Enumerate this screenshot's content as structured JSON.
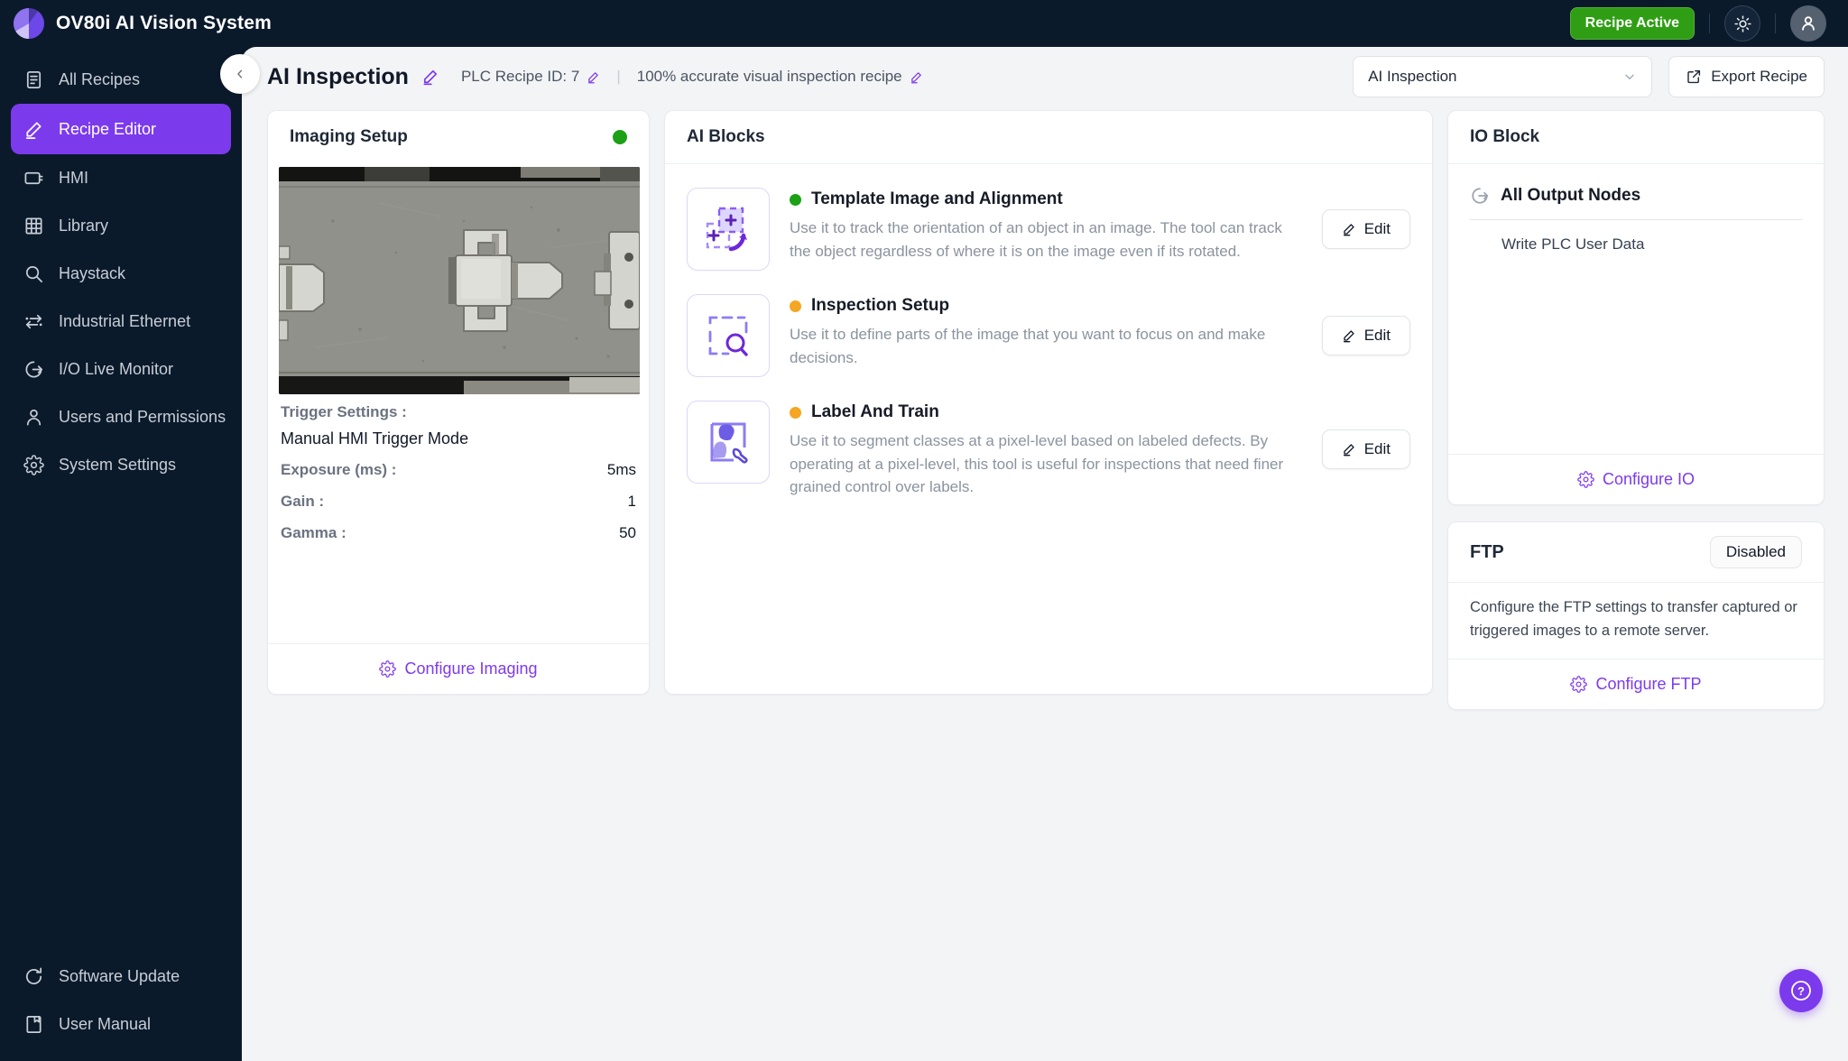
{
  "theme": {
    "accent": "#7c3aed",
    "navy": "#0b1a2b",
    "badge_green": "#2f9e15",
    "status_green": "#1ca016",
    "status_orange": "#f5a623"
  },
  "topbar": {
    "app_title": "OV80i AI Vision System",
    "status_badge": "Recipe Active"
  },
  "sidebar": {
    "items": [
      {
        "label": "All Recipes",
        "icon": "recipes-icon"
      },
      {
        "label": "Recipe Editor",
        "icon": "recipe-editor-icon",
        "active": true
      },
      {
        "label": "HMI",
        "icon": "hmi-icon"
      },
      {
        "label": "Library",
        "icon": "library-icon"
      },
      {
        "label": "Haystack",
        "icon": "search-icon"
      },
      {
        "label": "Industrial Ethernet",
        "icon": "ethernet-icon"
      },
      {
        "label": "I/O Live Monitor",
        "icon": "io-monitor-icon"
      },
      {
        "label": "Users and Permissions",
        "icon": "users-icon"
      },
      {
        "label": "System Settings",
        "icon": "settings-icon"
      }
    ],
    "bottom_items": [
      {
        "label": "Software Update",
        "icon": "refresh-icon"
      },
      {
        "label": "User Manual",
        "icon": "manual-icon"
      }
    ]
  },
  "header": {
    "recipe_name": "AI Inspection",
    "plc_recipe_id": "PLC Recipe ID: 7",
    "divider": "|",
    "recipe_description": "100% accurate visual inspection recipe",
    "recipe_select_value": "AI Inspection",
    "export_label": "Export Recipe"
  },
  "imaging_setup": {
    "title": "Imaging Setup",
    "trigger_label": "Trigger Settings :",
    "trigger_value": "Manual HMI Trigger Mode",
    "settings": [
      {
        "label": "Exposure (ms) :",
        "value": "5ms"
      },
      {
        "label": "Gain :",
        "value": "1"
      },
      {
        "label": "Gamma :",
        "value": "50"
      }
    ],
    "footer_action": "Configure Imaging"
  },
  "ai_blocks": {
    "title": "AI Blocks",
    "edit_label": "Edit",
    "blocks": [
      {
        "name": "Template Image and Alignment",
        "status_color": "#1ca016",
        "description": "Use it to track the orientation of an object in an image. The tool can track the object regardless of where it is on the image even if its rotated."
      },
      {
        "name": "Inspection Setup",
        "status_color": "#f5a623",
        "description": "Use it to define parts of the image that you want to focus on and make decisions."
      },
      {
        "name": "Label And Train",
        "status_color": "#f5a623",
        "description": "Use it to segment classes at a pixel-level based on labeled defects. By operating at a pixel-level, this tool is useful for inspections that need finer grained control over labels."
      }
    ]
  },
  "io_block": {
    "title": "IO Block",
    "section_title": "All Output Nodes",
    "node_label": "Write PLC User Data",
    "footer_action": "Configure IO"
  },
  "ftp": {
    "title": "FTP",
    "status": "Disabled",
    "description": "Configure the FTP settings to transfer captured or triggered images to a remote server.",
    "footer_action": "Configure FTP"
  },
  "help": {
    "label": "?"
  }
}
